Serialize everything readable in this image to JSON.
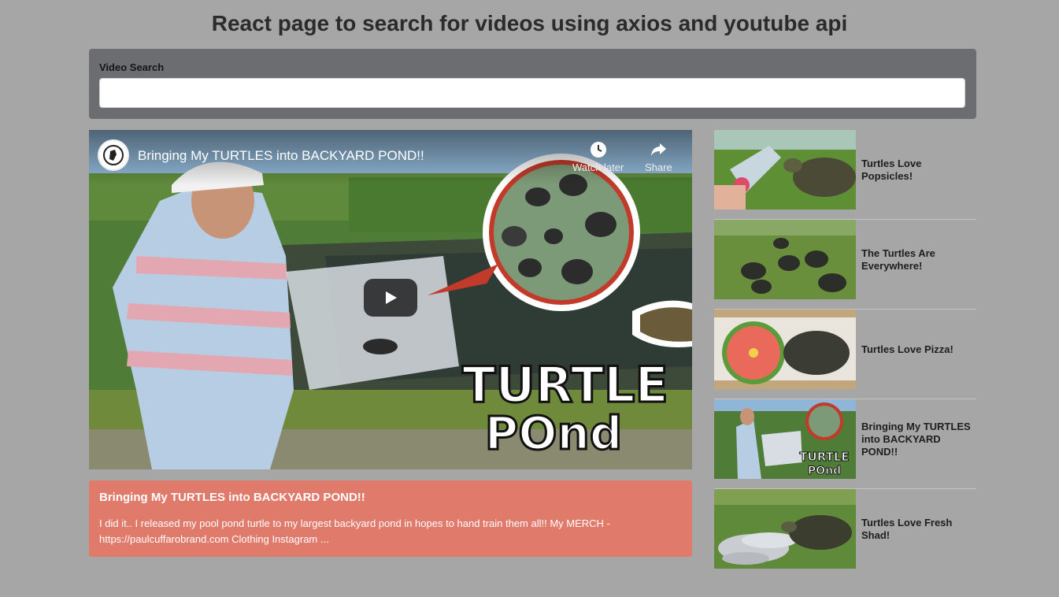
{
  "page": {
    "title": "React page to search for videos using axios and youtube api"
  },
  "search": {
    "label": "Video Search",
    "value": "",
    "placeholder": ""
  },
  "player": {
    "title": "Bringing My TURTLES into BACKYARD POND!!",
    "watch_later_label": "Watch later",
    "share_label": "Share",
    "thumbnail_text_line1": "TURTLE",
    "thumbnail_text_line2": "POnd"
  },
  "details": {
    "title": "Bringing My TURTLES into BACKYARD POND!!",
    "description": "I did it.. I released my pool pond turtle to my largest backyard pond in hopes to hand train them all!! My MERCH - https://paulcuffarobrand.com Clothing Instagram ..."
  },
  "video_list": [
    {
      "title": "Turtles Love Popsicles!"
    },
    {
      "title": "The Turtles Are Everywhere!"
    },
    {
      "title": "Turtles Love Pizza!"
    },
    {
      "title": "Bringing My TURTLES into BACKYARD POND!!"
    },
    {
      "title": "Turtles Love Fresh Shad!"
    }
  ],
  "colors": {
    "background": "#a6a6a6",
    "search_panel": "#6c6d70",
    "details_panel": "#e07a6b"
  }
}
